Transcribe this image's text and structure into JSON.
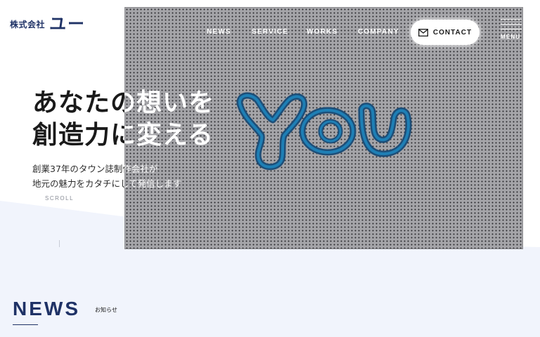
{
  "header": {
    "logo_sub": "株式会社",
    "logo_main": "ユー"
  },
  "nav": {
    "items": [
      "NEWS",
      "SERVICE",
      "WORKS",
      "COMPANY"
    ],
    "contact_label": "CONTACT",
    "menu_label": "MENU"
  },
  "hero": {
    "headline_line1": "あなたの想いを",
    "headline_line2": "創造力に変える",
    "lead_line1": "創業37年のタウン誌制作会社が",
    "lead_line2": "地元の魅力をカタチにして発信します",
    "scroll_label": "SCROLL",
    "art_icon": "you-lettering-illustration"
  },
  "news": {
    "title": "NEWS",
    "subtitle": "お知らせ"
  },
  "colors": {
    "brand_navy": "#1f3266",
    "pale_blue_bg": "#f1f4fc",
    "hero_grey": "#a4a4a8",
    "art_outline": "#1a6a9a"
  }
}
